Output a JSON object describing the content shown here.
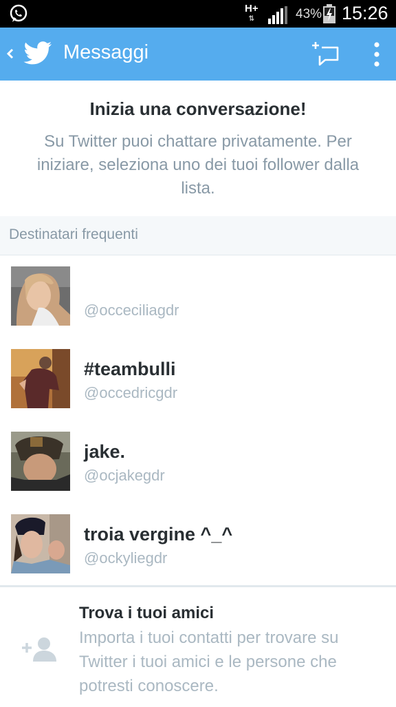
{
  "status_bar": {
    "network": "H+",
    "battery_percent": "43%",
    "time": "15:26",
    "icons": [
      "whatsapp-icon",
      "network-arrows-icon",
      "signal-icon",
      "battery-charging-icon"
    ]
  },
  "header": {
    "title": "Messaggi",
    "accent_color": "#55acee",
    "icons": [
      "back-chevron-icon",
      "twitter-bird-icon",
      "new-message-icon",
      "overflow-menu-icon"
    ]
  },
  "intro": {
    "title": "Inizia una conversazione!",
    "text": "Su Twitter puoi chattare privatamente. Per iniziare, seleziona uno dei tuoi follower dalla lista."
  },
  "frequent": {
    "header": "Destinatari frequenti",
    "contacts": [
      {
        "name": "",
        "handle": "@occeciliagdr"
      },
      {
        "name": "#teambulli",
        "handle": "@occedricgdr"
      },
      {
        "name": "jake.",
        "handle": "@ocjakegdr"
      },
      {
        "name": "troia vergine ^_^",
        "handle": "@ockyliegdr"
      }
    ]
  },
  "find_friends": {
    "title": "Trova i tuoi amici",
    "text": "Importa i tuoi contatti per trovare su Twitter i tuoi amici e le persone che potresti conoscere.",
    "icon": "add-person-icon"
  }
}
